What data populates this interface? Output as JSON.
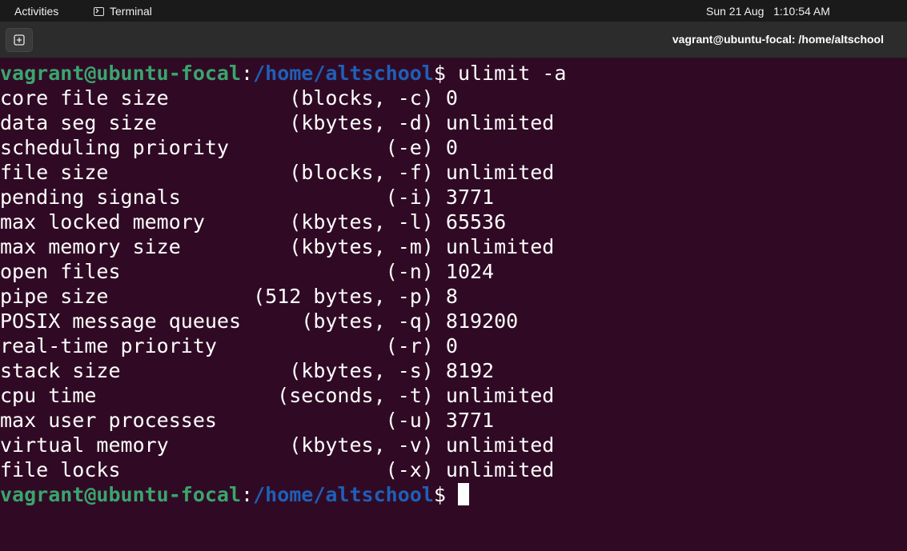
{
  "topbar": {
    "activities": "Activities",
    "app_name": "Terminal",
    "clock": "Sun 21 Aug   1:10:54 AM"
  },
  "window": {
    "title": "vagrant@ubuntu-focal: /home/altschool"
  },
  "terminal": {
    "prompt": {
      "user_host": "vagrant@ubuntu-focal",
      "colon": ":",
      "path": "/home/altschool",
      "dollar": "$ "
    },
    "command": "ulimit -a",
    "output_lines": [
      "core file size          (blocks, -c) 0",
      "data seg size           (kbytes, -d) unlimited",
      "scheduling priority             (-e) 0",
      "file size               (blocks, -f) unlimited",
      "pending signals                 (-i) 3771",
      "max locked memory       (kbytes, -l) 65536",
      "max memory size         (kbytes, -m) unlimited",
      "open files                      (-n) 1024",
      "pipe size            (512 bytes, -p) 8",
      "POSIX message queues     (bytes, -q) 819200",
      "real-time priority              (-r) 0",
      "stack size              (kbytes, -s) 8192",
      "cpu time               (seconds, -t) unlimited",
      "max user processes              (-u) 3771",
      "virtual memory          (kbytes, -v) unlimited",
      "file locks                      (-x) unlimited"
    ]
  },
  "colors": {
    "terminal_bg": "#300a24",
    "prompt_user": "#3aa56e",
    "prompt_path": "#1f5fb8",
    "text": "#ffffff"
  }
}
